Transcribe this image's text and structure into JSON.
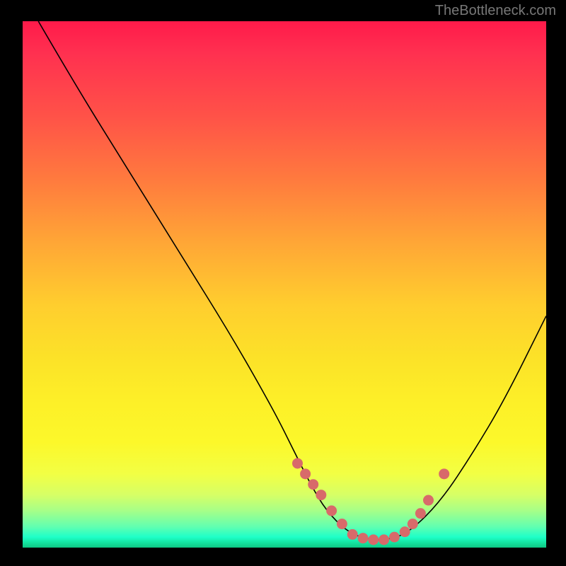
{
  "watermark": "TheBottleneck.com",
  "chart_data": {
    "type": "line",
    "title": "",
    "xlabel": "",
    "ylabel": "",
    "xlim": [
      0,
      100
    ],
    "ylim": [
      0,
      100
    ],
    "series": [
      {
        "name": "curve",
        "x": [
          3,
          10,
          20,
          30,
          40,
          48,
          52,
          55,
          58,
          62,
          66,
          70,
          74,
          80,
          86,
          92,
          100
        ],
        "values": [
          100,
          88,
          72,
          56,
          40,
          26,
          18,
          12,
          7,
          3,
          1.5,
          1.5,
          3,
          9,
          18,
          28,
          44
        ]
      }
    ],
    "highlight_points": {
      "name": "dots",
      "x": [
        52.5,
        54,
        55.5,
        57,
        59,
        61,
        63,
        65,
        67,
        69,
        71,
        73,
        74.5,
        76,
        77.5,
        80.5
      ],
      "values": [
        16,
        14,
        12,
        10,
        7,
        4.5,
        2.5,
        1.8,
        1.5,
        1.5,
        2,
        3,
        4.5,
        6.5,
        9,
        14
      ]
    }
  }
}
